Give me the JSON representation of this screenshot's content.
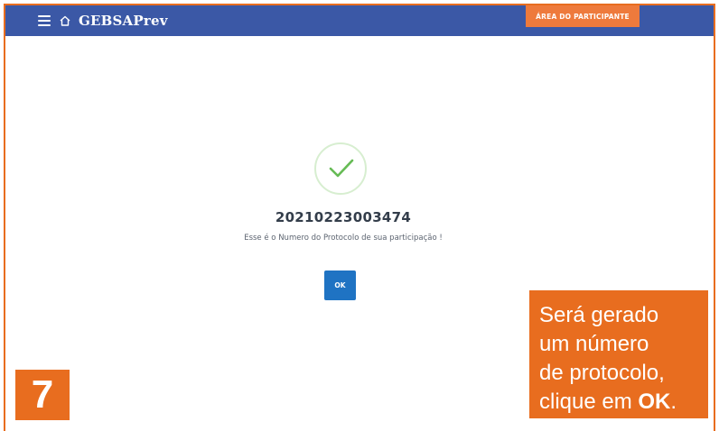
{
  "header": {
    "brand": "GEBSAPrev",
    "area_button_label": "ÁREA DO PARTICIPANTE"
  },
  "dialog": {
    "protocol_number": "20210223003474",
    "message": "Esse é o Numero do Protocolo de sua participação !",
    "ok_label": "OK"
  },
  "callout": {
    "line1": "Será gerado",
    "line2": "um número",
    "line3": "de protocolo,",
    "line4_prefix": "clique em ",
    "line4_bold": "OK",
    "line4_suffix": "."
  },
  "step_number": "7",
  "colors": {
    "header_bg": "#3b58a6",
    "accent_orange": "#e86d1f",
    "ok_button": "#1f73c3",
    "check_green": "#66bb55"
  },
  "icons": {
    "menu": "hamburger-icon",
    "home": "home-icon",
    "success": "checkmark-icon"
  }
}
